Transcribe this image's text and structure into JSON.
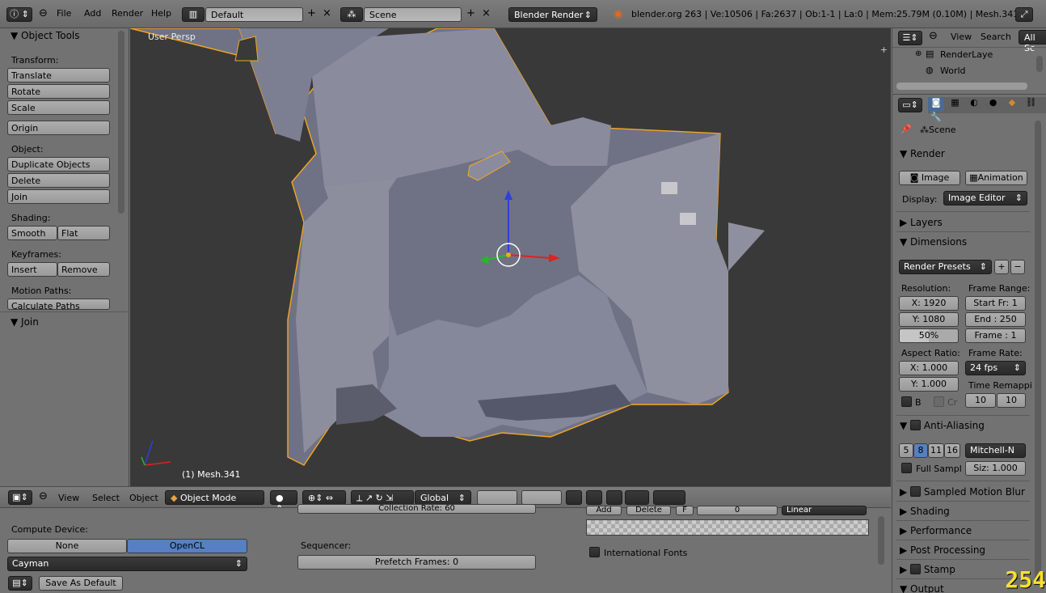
{
  "header": {
    "menus": [
      "File",
      "Add",
      "Render",
      "Help"
    ],
    "screen_layout": "Default",
    "scene": "Scene",
    "render_engine": "Blender Render",
    "stats": "blender.org 263 | Ve:10506 | Fa:2637 | Ob:1-1 | La:0 | Mem:25.79M (0.10M) | Mesh.341"
  },
  "toolshelf": {
    "title": "Object Tools",
    "transform_label": "Transform:",
    "translate": "Translate",
    "rotate": "Rotate",
    "scale": "Scale",
    "origin": "Origin",
    "object_label": "Object:",
    "duplicate": "Duplicate Objects",
    "delete": "Delete",
    "join": "Join",
    "shading_label": "Shading:",
    "smooth": "Smooth",
    "flat": "Flat",
    "keyframes_label": "Keyframes:",
    "insert": "Insert",
    "remove": "Remove",
    "motion_paths_label": "Motion Paths:",
    "calculate_paths": "Calculate Paths",
    "operator_panel": "Join"
  },
  "viewport": {
    "view_name": "User Persp",
    "object_label": "(1) Mesh.341"
  },
  "viewport_header": {
    "menus": [
      "View",
      "Select",
      "Object"
    ],
    "mode": "Object Mode",
    "orientation": "Global"
  },
  "prefs": {
    "compute_device_label": "Compute Device:",
    "none": "None",
    "opencl": "OpenCL",
    "device": "Cayman",
    "collection_rate": "Collection Rate: 60",
    "sequencer_label": "Sequencer:",
    "prefetch": "Prefetch Frames: 0",
    "add": "Add",
    "delete": "Delete",
    "f": "F",
    "zero": "0",
    "interp": "Linear",
    "intl_fonts": "International Fonts",
    "save_default": "Save As Default"
  },
  "outliner": {
    "menus": [
      "View",
      "Search"
    ],
    "filter": "All Sc",
    "items": [
      "RenderLaye",
      "World"
    ]
  },
  "properties": {
    "scene": "Scene",
    "render_panel": "Render",
    "image_btn": "Image",
    "animation_btn": "Animation",
    "display_label": "Display:",
    "display_value": "Image Editor",
    "layers": "Layers",
    "dimensions": "Dimensions",
    "render_presets": "Render Presets",
    "resolution_label": "Resolution:",
    "res_x": "X: 1920",
    "res_y": "Y: 1080",
    "res_pct": "50%",
    "frame_range_label": "Frame Range:",
    "start": "Start Fr: 1",
    "end": "End : 250",
    "frame": "Frame : 1",
    "aspect_label": "Aspect Ratio:",
    "asp_x": "X: 1.000",
    "asp_y": "Y: 1.000",
    "frame_rate_label": "Frame Rate:",
    "fps": "24 fps",
    "time_remap_label": "Time Remappi",
    "b": "B",
    "cr": "Cr",
    "remap_old": "10",
    "remap_new": "10",
    "aa": "Anti-Aliasing",
    "aa_samples": [
      "5",
      "8",
      "11",
      "16"
    ],
    "aa_filter": "Mitchell-N",
    "full_sample": "Full Sampl",
    "siz": "Siz: 1.000",
    "motion_blur": "Sampled Motion Blur",
    "shading": "Shading",
    "performance": "Performance",
    "post_processing": "Post Processing",
    "stamp": "Stamp",
    "output": "Output"
  },
  "fps_counter": "254",
  "colors": {
    "mesh_fill": "#8a8b9c",
    "selection_outline": "#f5a623",
    "active_toggle": "#5680c2",
    "viewport_bg": "#393939"
  }
}
